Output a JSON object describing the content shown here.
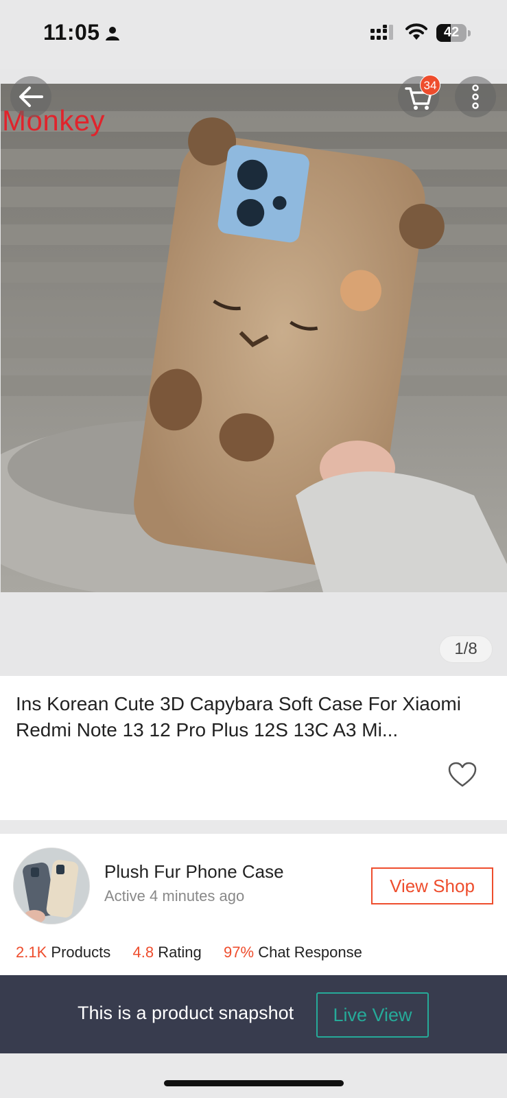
{
  "status_bar": {
    "time": "11:05",
    "battery": "42"
  },
  "gallery": {
    "watermark": "Monkey",
    "cart_count": "34",
    "counter": "1/8"
  },
  "product": {
    "title": "Ins Korean Cute 3D Capybara Soft Case For Xiaomi Redmi Note 13 12 Pro Plus 12S 13C A3 Mi..."
  },
  "shop": {
    "name": "Plush Fur Phone Case",
    "active": "Active 4 minutes ago",
    "view_shop_label": "View Shop",
    "stats": [
      {
        "value": "2.1K",
        "label": "Products"
      },
      {
        "value": "4.8",
        "label": "Rating"
      },
      {
        "value": "97%",
        "label": "Chat Response"
      }
    ]
  },
  "snapshot": {
    "text": "This is a product snapshot",
    "live_view_label": "Live View"
  },
  "colors": {
    "accent": "#ee4d2d",
    "teal": "#26aa99",
    "snapshot_bg": "#383c4e"
  }
}
